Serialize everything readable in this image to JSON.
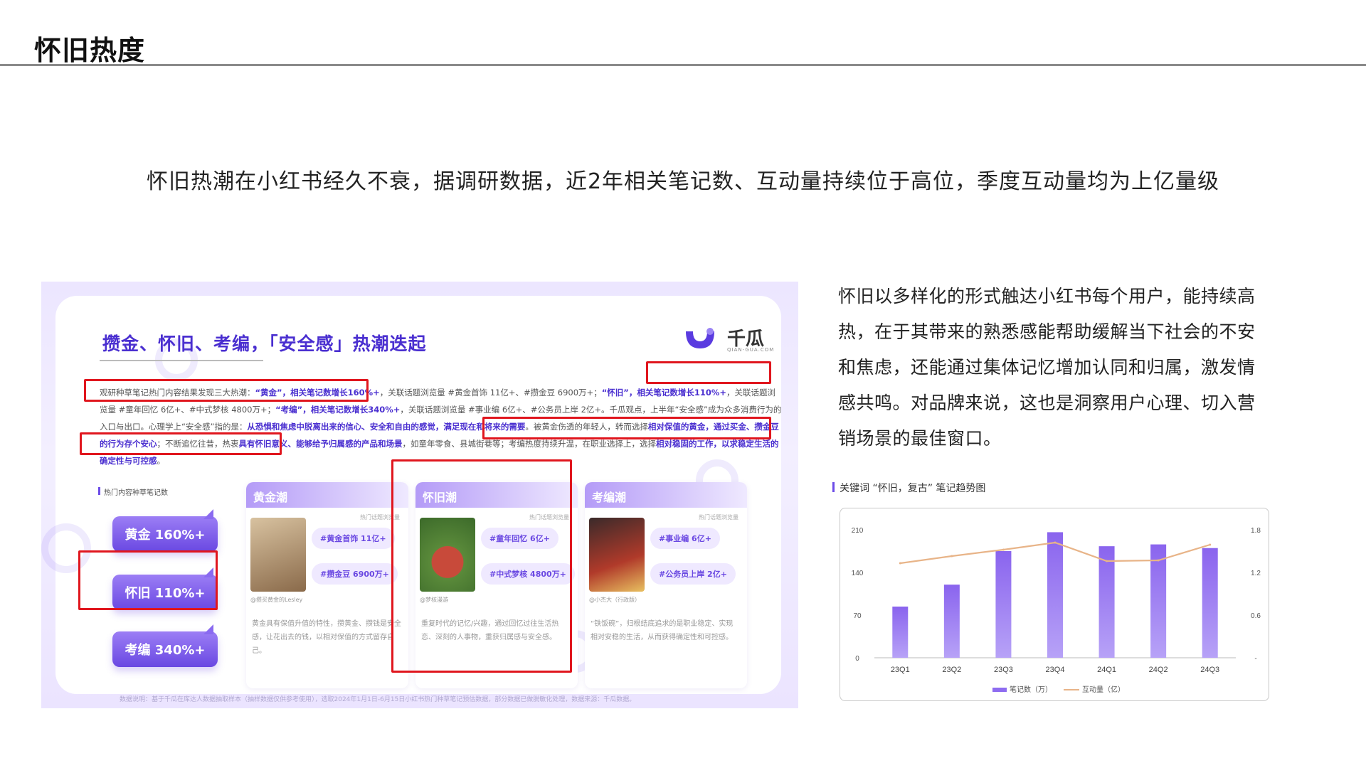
{
  "page": {
    "title": "怀旧热度",
    "headline": "怀旧热潮在小红书经久不衰，据调研数据，近2年相关笔记数、互动量持续位于高位，季度互动量均为上亿量级",
    "side_paragraph": "怀旧以多样化的形式触达小红书每个用户，能持续高热，在于其带来的熟悉感能帮助缓解当下社会的不安和焦虑，还能通过集体记忆增加认同和归属，激发情感共鸣。对品牌来说，这也是洞察用户心理、切入营销场景的最佳窗口。",
    "chart_caption": "关键词 “怀旧，复古” 笔记趋势图"
  },
  "report": {
    "title": "攒金、怀旧、考编，「安全感」热潮迭起",
    "logo_text": "千瓜",
    "logo_sub": "QIAN-GUA.COM",
    "paragraph": [
      {
        "t": "观研种草笔记热门内容结果发现三大热潮：",
        "hl": false
      },
      {
        "t": "“黄金”，相关笔记数增长160%+",
        "hl": true
      },
      {
        "t": "，关联话题浏览量 #黄金首饰 11亿+、#攒金豆 6900万+；",
        "hl": false
      },
      {
        "t": "“怀旧”，相关笔记数增长110%+",
        "hl": true
      },
      {
        "t": "，关联话题浏览量 #童年回忆 6亿+、#中式梦核 4800万+；",
        "hl": false
      },
      {
        "t": "“考编”，相关笔记数增长340%+",
        "hl": true
      },
      {
        "t": "，关联话题浏览量 #事业编 6亿+、#公务员上岸 2亿+。千瓜观点，上半年“安全感”成为众多消费行为的入口与出口。心理学上“安全感”指的是：",
        "hl": false
      },
      {
        "t": "从恐惧和焦虑中脱离出来的信心、安全和自由的感觉，满足现在和将来的需要",
        "hl": true
      },
      {
        "t": "。被黄金伤透的年轻人，转而选择",
        "hl": false
      },
      {
        "t": "相对保值的黄金，通过买金、攒金豆的行为存个安心",
        "hl": true
      },
      {
        "t": "；不断追忆往昔，热衷",
        "hl": false
      },
      {
        "t": "具有怀旧意义、能够给予归属感的产品和场景",
        "hl": true
      },
      {
        "t": "，如童年零食、县城街巷等；考编热度持续升温，在职业选择上，选择",
        "hl": false
      },
      {
        "t": "相对稳固的工作，以求稳定生活的确定性与可控感",
        "hl": true
      },
      {
        "t": "。",
        "hl": false
      }
    ],
    "legend": "热门内容种草笔记数",
    "tags": [
      "黄金 160%+",
      "怀旧 110%+",
      "考编 340%+"
    ],
    "columns": [
      {
        "head": "黄金潮",
        "sub": "热门话题浏览量",
        "pills": [
          "#黄金首饰 11亿+",
          "#攒金豆 6900万+"
        ],
        "user": "@攒买黄金的Lesley",
        "desc": "黄金具有保值升值的特性，攒黄金、攒钱是安全感，让花出去的钱，以相对保值的方式留存自己。"
      },
      {
        "head": "怀旧潮",
        "sub": "热门话题浏览量",
        "pills": [
          "#童年回忆 6亿+",
          "#中式梦核 4800万+"
        ],
        "user": "@梦核漫游",
        "desc": "重复时代的记忆/兴趣，通过回忆过往生活热恋、深刻的人事物，重获归属感与安全感。"
      },
      {
        "head": "考编潮",
        "sub": "热门话题浏览量",
        "pills": [
          "#事业编 6亿+",
          "#公务员上岸 2亿+"
        ],
        "user": "@小杰大（行政版）",
        "desc": "“铁饭碗”，归根结底追求的是职业稳定、实现相对安稳的生活，从而获得确定性和可控感。"
      }
    ],
    "footnote": "数据说明：基于千瓜在库达人数据抽取样本（抽样数据仅供参考使用），选取2024年1月1日-6月15日小红书热门种草笔记预估数据，部分数据已做脱敏化处理，数据来源：千瓜数据。"
  },
  "colors": {
    "accent": "#6c4ce8",
    "bar": "#8e6cf0",
    "line": "#e8b488",
    "highlight_box": "#e0161e"
  },
  "chart_data": {
    "type": "bar",
    "categories": [
      "23Q1",
      "23Q2",
      "23Q3",
      "23Q4",
      "24Q1",
      "24Q2",
      "24Q3"
    ],
    "series": [
      {
        "name": "笔记数（万）",
        "type": "bar",
        "axis": "left",
        "values": [
          84,
          120,
          175,
          206,
          183,
          186,
          180
        ]
      },
      {
        "name": "互动量（亿）",
        "type": "line",
        "axis": "right",
        "values": [
          1.33,
          1.43,
          1.52,
          1.62,
          1.36,
          1.37,
          1.59
        ]
      }
    ],
    "y_left": {
      "ticks": [
        0,
        70,
        140,
        210
      ],
      "range": [
        0,
        210
      ]
    },
    "y_right": {
      "ticks": [
        "-",
        "0.6",
        "1.2",
        "1.8"
      ],
      "range": [
        0,
        1.8
      ]
    },
    "legend_position": "bottom",
    "grid": false
  }
}
